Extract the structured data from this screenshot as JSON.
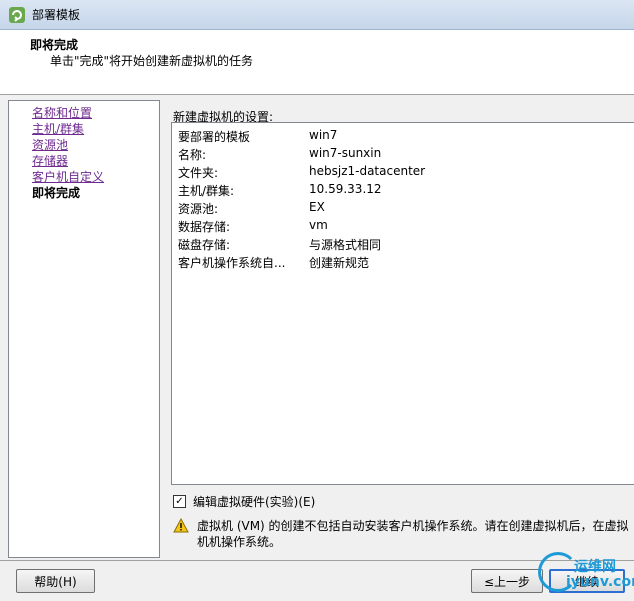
{
  "window": {
    "title": "部署模板",
    "icon": "vsphere-template-icon"
  },
  "header": {
    "title": "即将完成",
    "subtitle": "单击\"完成\"将开始创建新虚拟机的任务"
  },
  "nav": {
    "items": [
      {
        "label": "名称和位置",
        "current": false
      },
      {
        "label": "主机/群集",
        "current": false
      },
      {
        "label": "资源池",
        "current": false
      },
      {
        "label": "存储器",
        "current": false
      },
      {
        "label": "客户机自定义",
        "current": false
      },
      {
        "label": "即将完成",
        "current": true
      }
    ]
  },
  "settings": {
    "label": "新建虚拟机的设置:",
    "rows": [
      {
        "key": "要部署的模板",
        "value": "win7"
      },
      {
        "key": "名称:",
        "value": "win7-sunxin"
      },
      {
        "key": "文件夹:",
        "value": "hebsjz1-datacenter"
      },
      {
        "key": "主机/群集:",
        "value": "10.59.33.12"
      },
      {
        "key": "资源池:",
        "value": "EX"
      },
      {
        "key": "数据存储:",
        "value": "vm"
      },
      {
        "key": "磁盘存储:",
        "value": "与源格式相同"
      },
      {
        "key": "客户机操作系统自...",
        "value": "创建新规范"
      }
    ]
  },
  "edit_hardware": {
    "label": "编辑虚拟硬件(实验)(E)",
    "checked": true
  },
  "warning": {
    "icon": "warning-icon",
    "text": "虚拟机 (VM) 的创建不包括自动安装客户机操作系统。请在创建虚拟机后，在虚拟机机操作系统。"
  },
  "buttons": {
    "help": "帮助(H)",
    "back": "≤上一步",
    "next": "继续"
  },
  "watermark": {
    "top": "运维网",
    "bottom": "iyunv.com"
  },
  "colors": {
    "link": "#6f2a8f",
    "accent": "#2c6fd1",
    "watermark": "#1e9ad6"
  }
}
